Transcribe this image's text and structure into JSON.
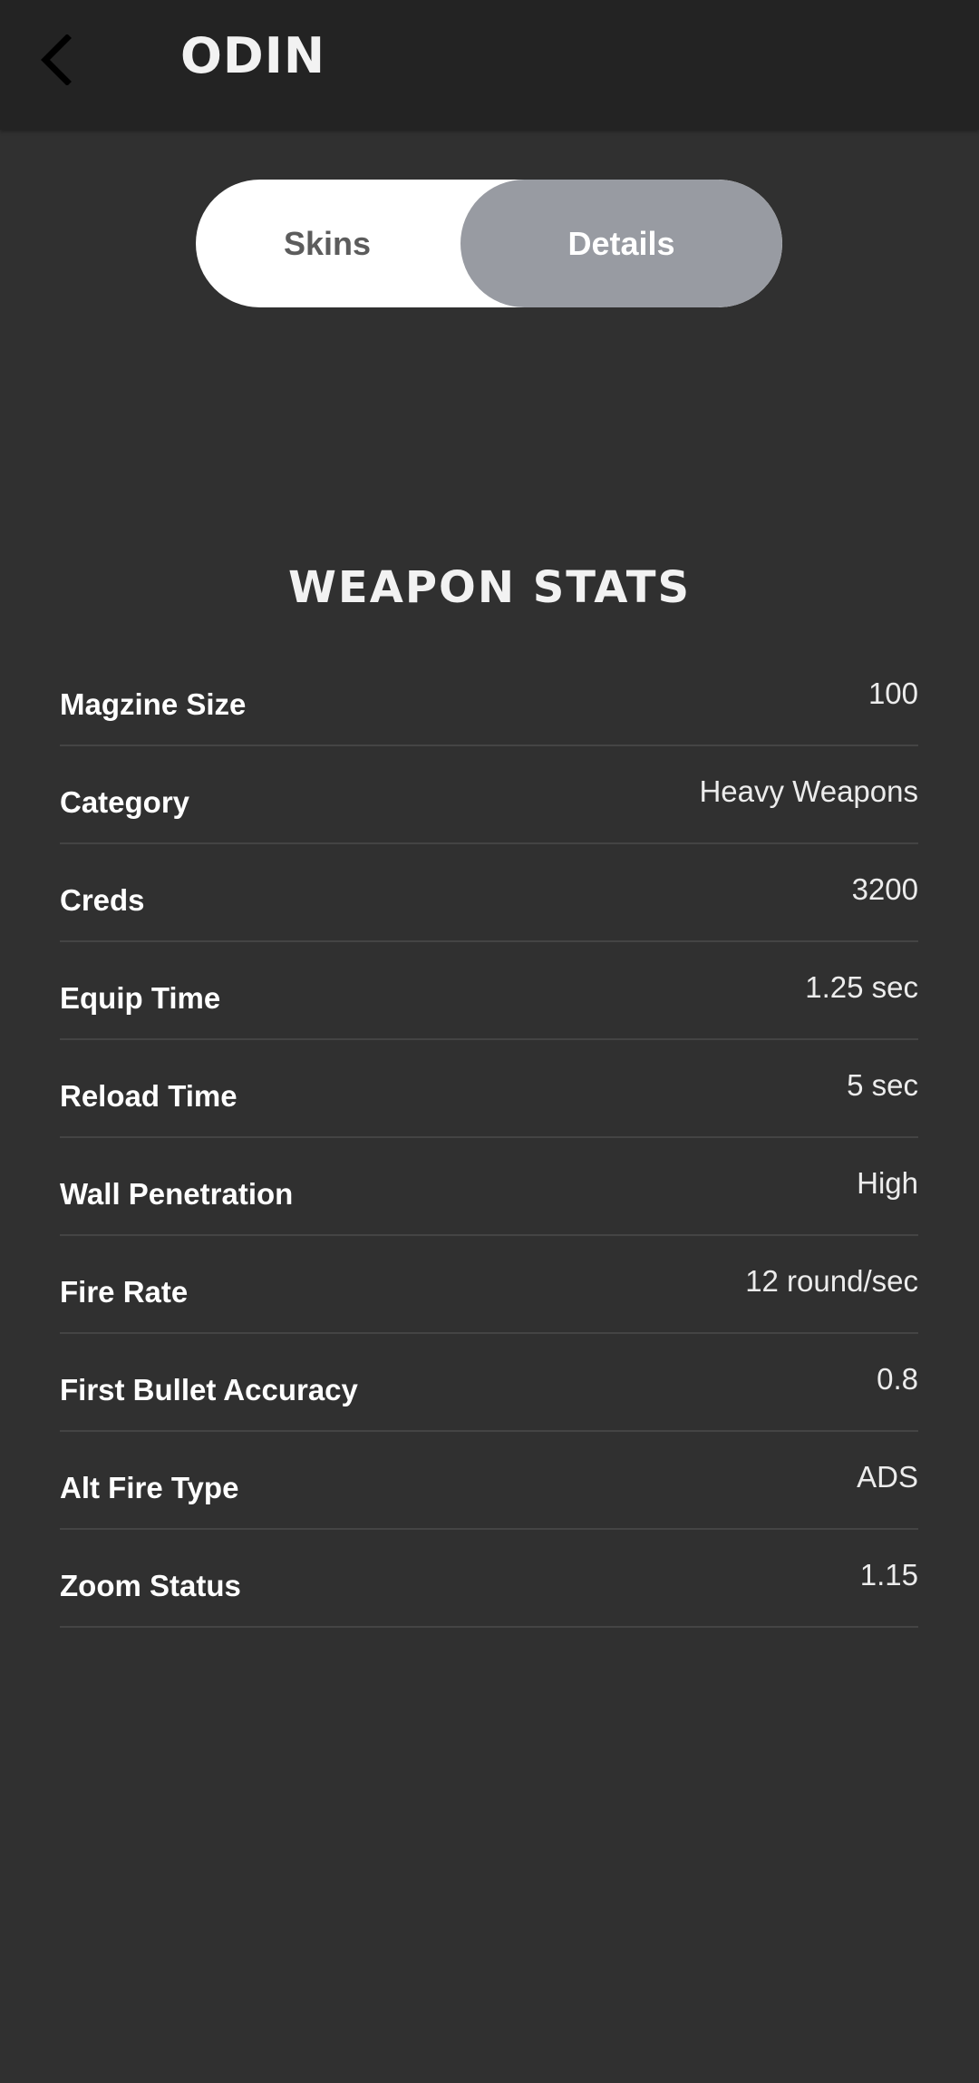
{
  "header": {
    "title": "ODIN",
    "back_icon": "chevron-left-icon"
  },
  "tabs": {
    "items": [
      {
        "label": "Skins",
        "selected": false
      },
      {
        "label": "Details",
        "selected": true
      }
    ],
    "colors": {
      "track": "#ffffff",
      "selected": "#989ba2"
    }
  },
  "section": {
    "title": "WEAPON STATS"
  },
  "stats": [
    {
      "label": "Magzine Size",
      "value": "100"
    },
    {
      "label": "Category",
      "value": "Heavy Weapons"
    },
    {
      "label": "Creds",
      "value": "3200"
    },
    {
      "label": "Equip Time",
      "value": "1.25 sec"
    },
    {
      "label": "Reload Time",
      "value": "5 sec"
    },
    {
      "label": "Wall Penetration",
      "value": "High"
    },
    {
      "label": "Fire Rate",
      "value": "12 round/sec"
    },
    {
      "label": "First Bullet Accuracy",
      "value": "0.8"
    },
    {
      "label": "Alt Fire Type",
      "value": "ADS"
    },
    {
      "label": "Zoom Status",
      "value": "1.15"
    }
  ],
  "colors": {
    "background": "#303030",
    "app_bar": "#232323",
    "divider": "#444444"
  }
}
